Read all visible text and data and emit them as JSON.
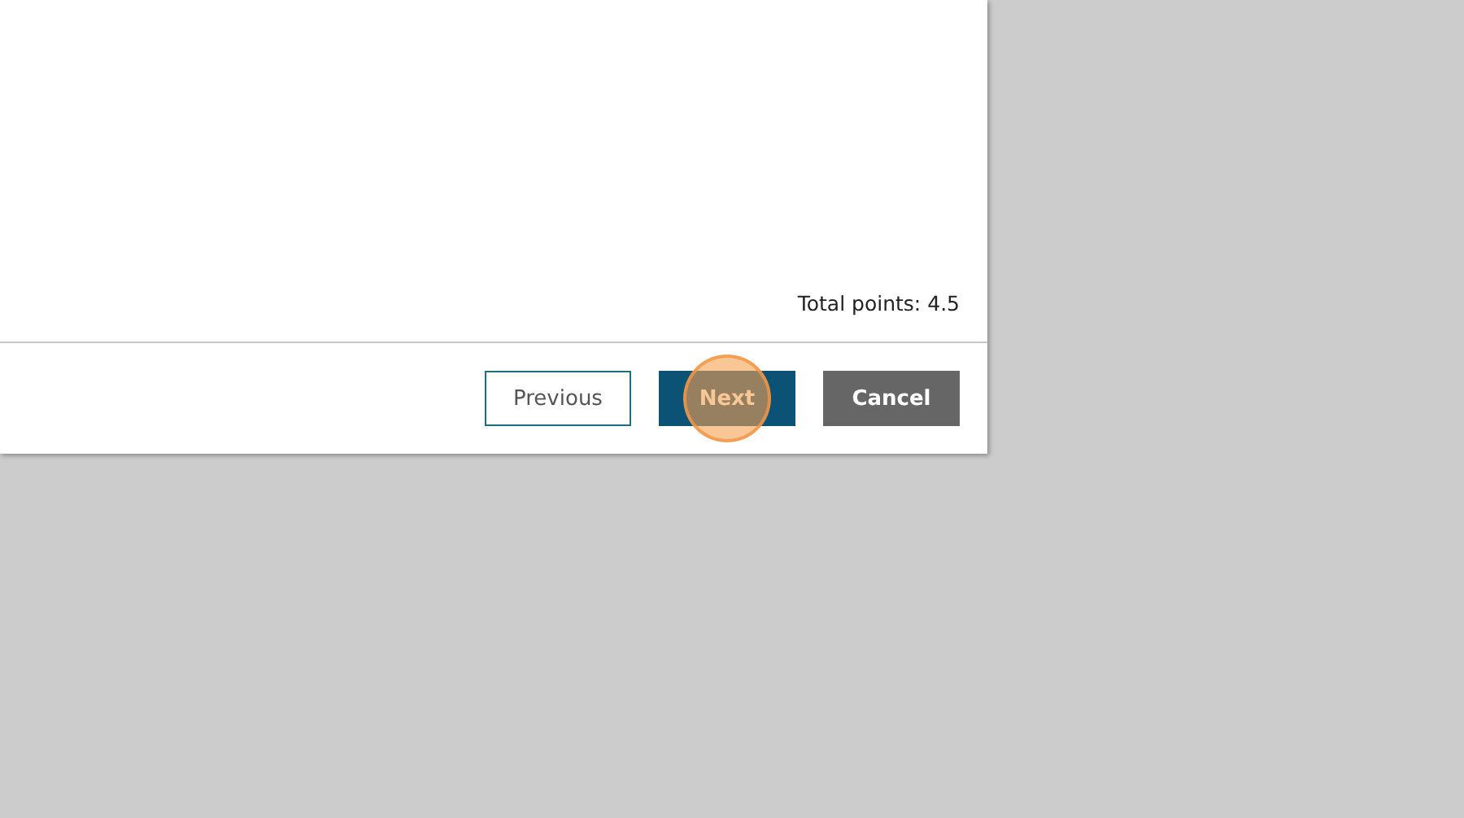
{
  "total_points": "Total points: 4.5",
  "buttons": [
    {
      "label": "Previous",
      "kind": "outline",
      "highlighted": false
    },
    {
      "label": "Next",
      "kind": "primary",
      "highlighted": true
    },
    {
      "label": "Cancel",
      "kind": "secondary",
      "highlighted": false
    }
  ]
}
